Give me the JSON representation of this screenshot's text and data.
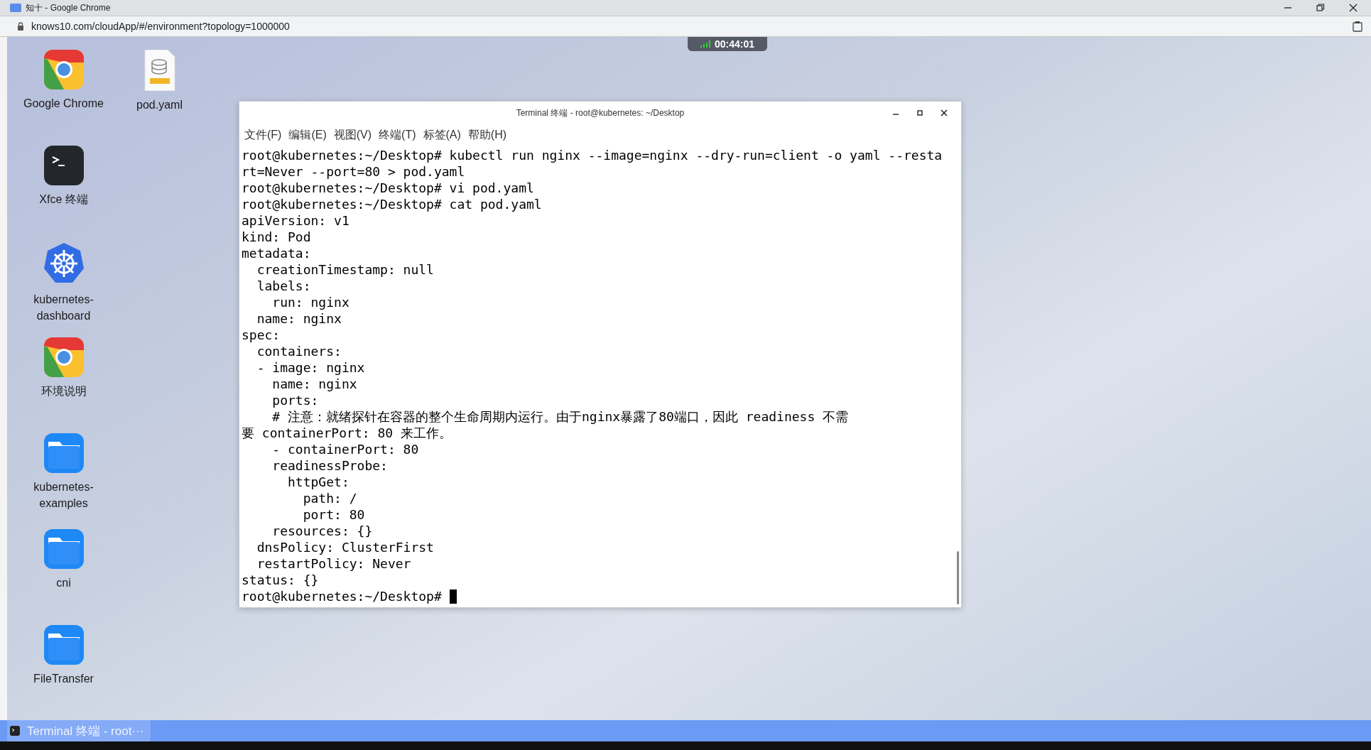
{
  "browser": {
    "title": "知十 - Google Chrome",
    "url": "knows10.com/cloudApp/#/environment?topology=1000000"
  },
  "session_timer": "00:44:01",
  "desktop_columns": [
    {
      "icons": [
        {
          "label": "Google Chrome",
          "kind": "chrome"
        },
        {
          "label": "Xfce 终端",
          "kind": "terminal"
        },
        {
          "label": "kubernetes-dashboard",
          "kind": "kubernetes"
        },
        {
          "label": "环境说明",
          "kind": "chrome"
        },
        {
          "label": "kubernetes-examples",
          "kind": "folder"
        },
        {
          "label": "cni",
          "kind": "folder"
        },
        {
          "label": "FileTransfer",
          "kind": "folder"
        }
      ]
    },
    {
      "icons": [
        {
          "label": "pod.yaml",
          "kind": "yaml"
        }
      ]
    }
  ],
  "terminal": {
    "title": "Terminal 终端 - root@kubernetes: ~/Desktop",
    "menu": [
      "文件(F)",
      "编辑(E)",
      "视图(V)",
      "终端(T)",
      "标签(A)",
      "帮助(H)"
    ],
    "lines": [
      "root@kubernetes:~/Desktop# kubectl run nginx --image=nginx --dry-run=client -o yaml --resta",
      "rt=Never --port=80 > pod.yaml",
      "root@kubernetes:~/Desktop# vi pod.yaml",
      "root@kubernetes:~/Desktop# cat pod.yaml",
      "apiVersion: v1",
      "kind: Pod",
      "metadata:",
      "  creationTimestamp: null",
      "  labels:",
      "    run: nginx",
      "  name: nginx",
      "spec:",
      "  containers:",
      "  - image: nginx",
      "    name: nginx",
      "    ports:",
      "    # 注意：就绪探针在容器的整个生命周期内运行。由于nginx暴露了80端口，因此 readiness 不需",
      "要 containerPort: 80 来工作。",
      "    - containerPort: 80",
      "    readinessProbe:",
      "      httpGet:",
      "        path: /",
      "        port: 80",
      "    resources: {}",
      "  dnsPolicy: ClusterFirst",
      "  restartPolicy: Never",
      "status: {}",
      "root@kubernetes:~/Desktop# "
    ],
    "cursor": true
  },
  "taskbar": [
    {
      "label": "Terminal 终端 - root···",
      "selected": true
    }
  ]
}
